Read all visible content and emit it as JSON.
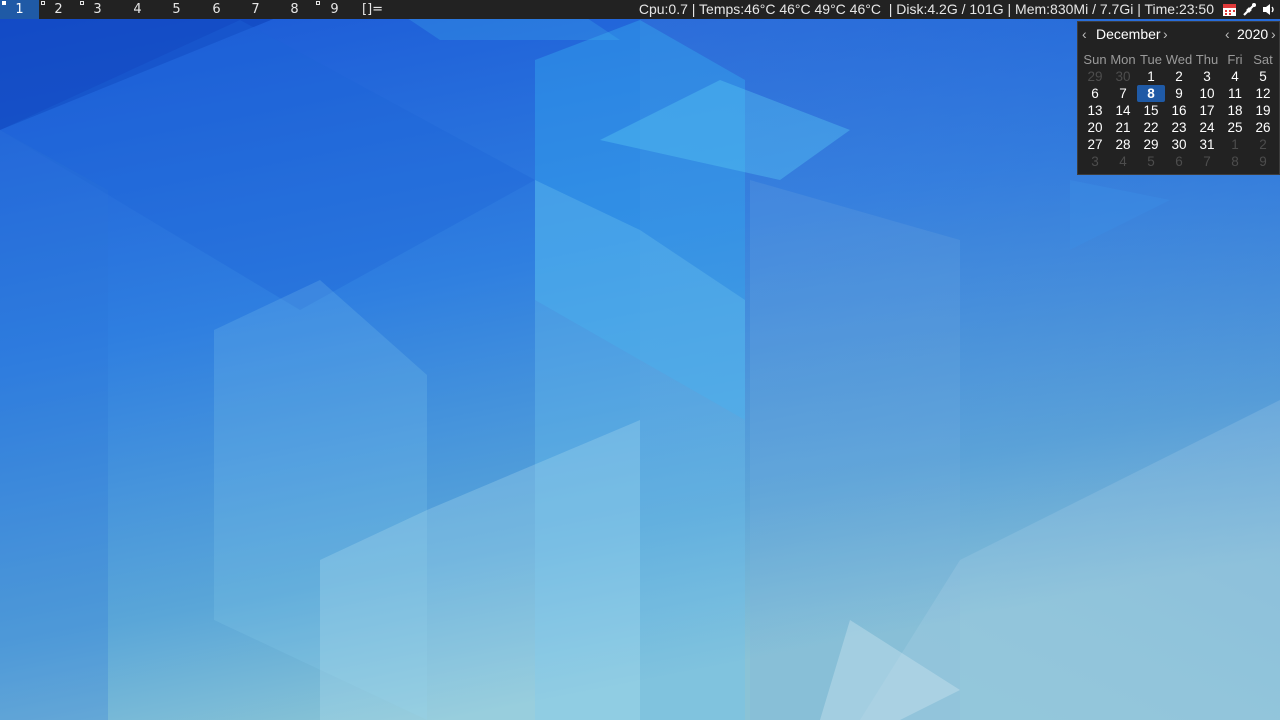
{
  "bar": {
    "tags": [
      "1",
      "2",
      "3",
      "4",
      "5",
      "6",
      "7",
      "8",
      "9"
    ],
    "layout_symbol": "[]=",
    "status_text": "Cpu:0.7 | Temps:46°C 46°C 49°C 46°C  | Disk:4.2G / 101G | Mem:830Mi / 7.7Gi | Time:23:50",
    "tray_icons": [
      "calendar-icon",
      "network-icon",
      "volume-icon"
    ]
  },
  "calendar": {
    "prev_month": "‹",
    "month": "December",
    "next_month": "›",
    "prev_year": "‹",
    "year": "2020",
    "next_year": "›",
    "weekdays": [
      "Sun",
      "Mon",
      "Tue",
      "Wed",
      "Thu",
      "Fri",
      "Sat"
    ],
    "weeks": [
      [
        "29",
        "30",
        "1",
        "2",
        "3",
        "4",
        "5"
      ],
      [
        "6",
        "7",
        "8",
        "9",
        "10",
        "11",
        "12"
      ],
      [
        "13",
        "14",
        "15",
        "16",
        "17",
        "18",
        "19"
      ],
      [
        "20",
        "21",
        "22",
        "23",
        "24",
        "25",
        "26"
      ],
      [
        "27",
        "28",
        "29",
        "30",
        "31",
        "1",
        "2"
      ],
      [
        "3",
        "4",
        "5",
        "6",
        "7",
        "8",
        "9"
      ]
    ],
    "today": "8"
  }
}
